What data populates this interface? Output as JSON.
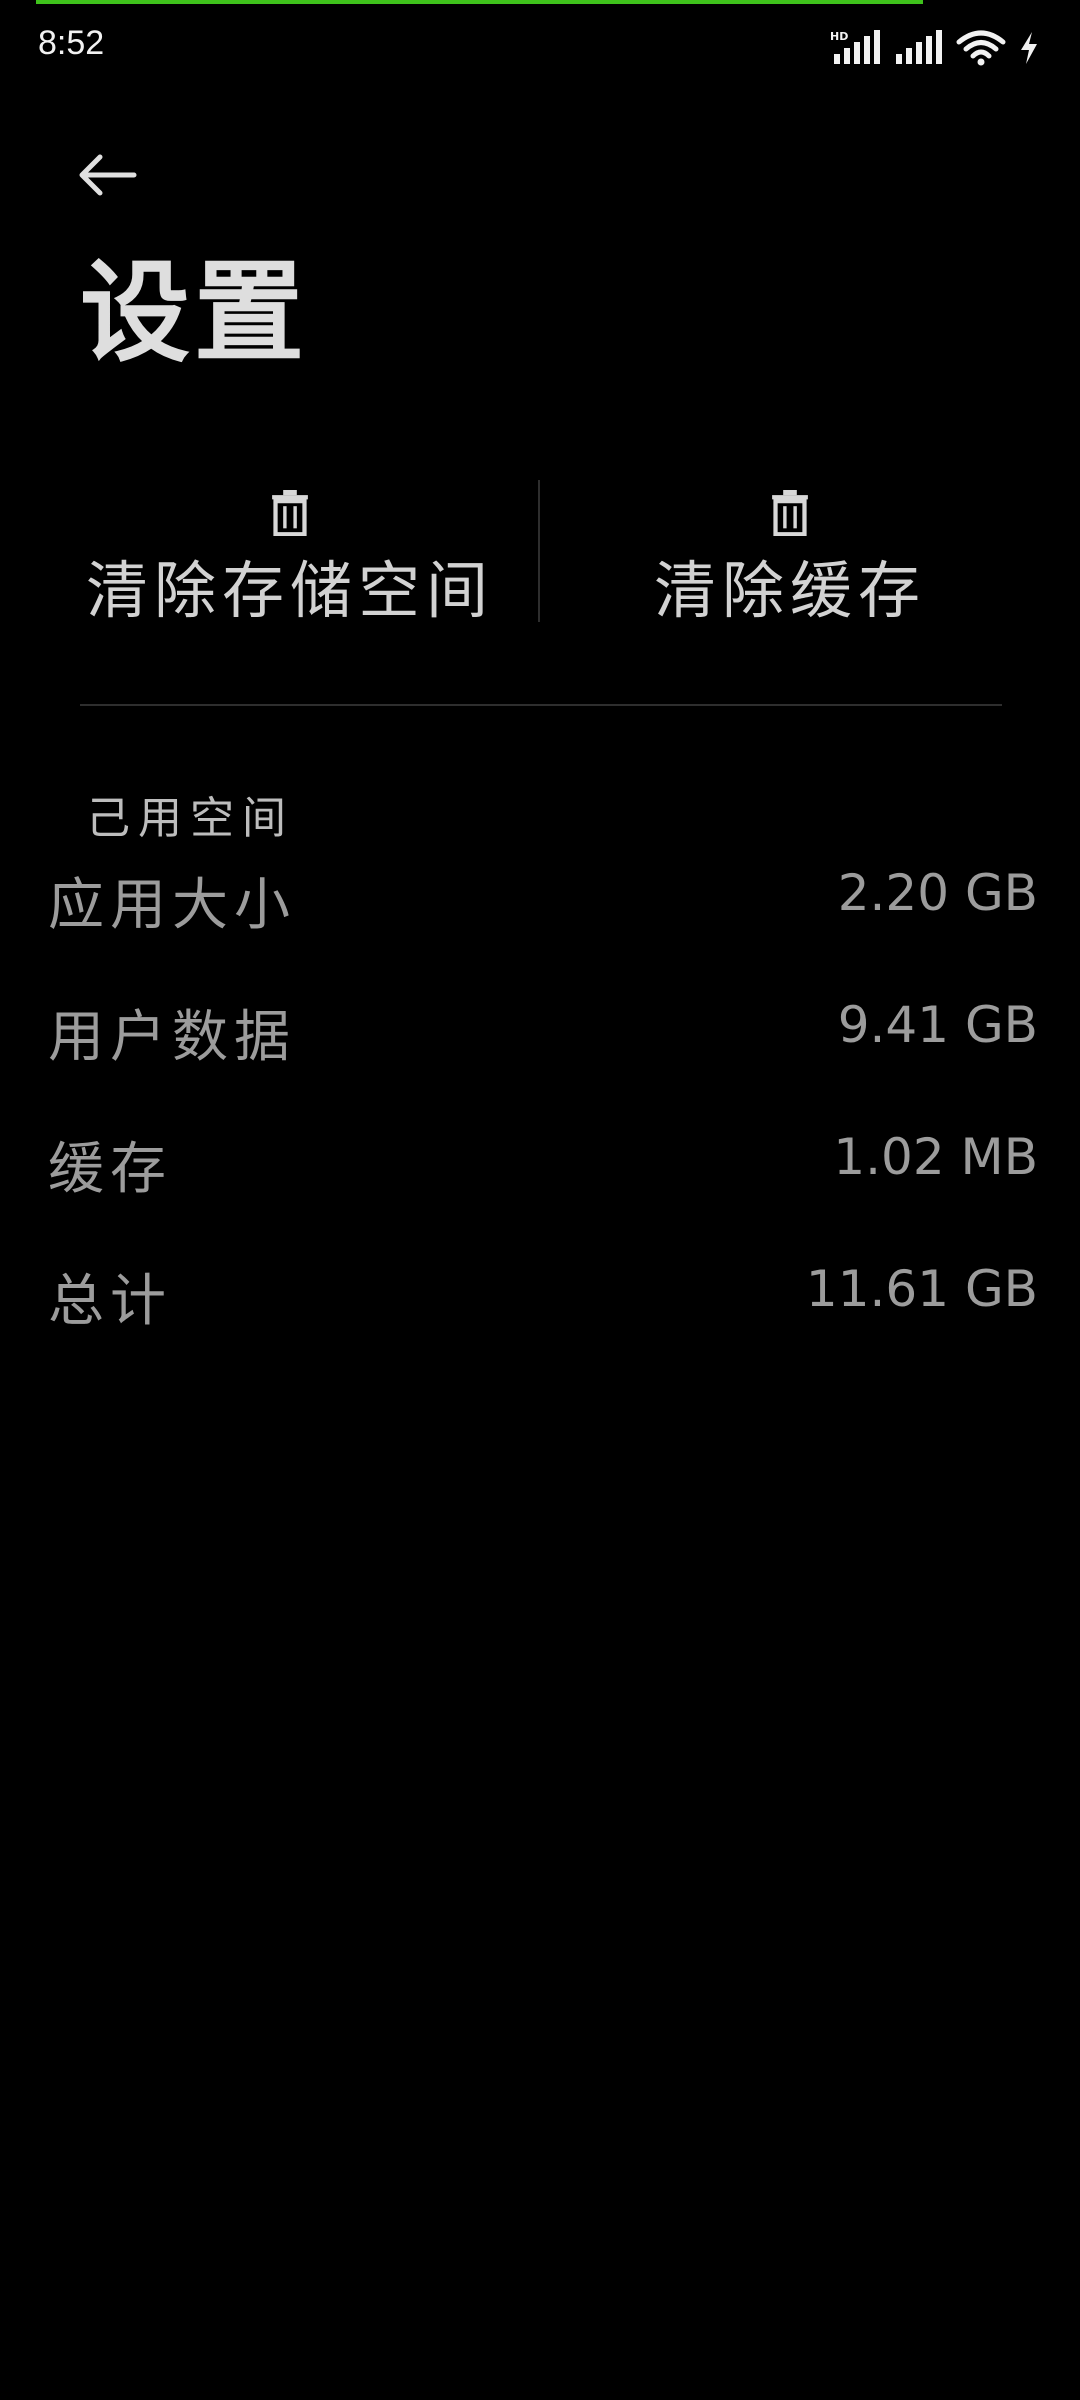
{
  "status_bar": {
    "time": "8:52",
    "network_badge": "HD"
  },
  "header": {
    "title": "设置"
  },
  "actions": {
    "clear_storage_label": "清除存储空间",
    "clear_cache_label": "清除缓存"
  },
  "storage": {
    "section_title": "己用空间",
    "rows": [
      {
        "label": "应用大小",
        "value": "2.20 GB"
      },
      {
        "label": "用户数据",
        "value": "9.41 GB"
      },
      {
        "label": "缓存",
        "value": "1.02 MB"
      },
      {
        "label": "总计",
        "value": "11.61 GB"
      }
    ]
  },
  "icons": {
    "back": "arrow-left-icon",
    "trash": "trash-icon",
    "signal": "cellular-signal-icon",
    "wifi": "wifi-icon",
    "charging": "charging-bolt-icon"
  },
  "colors": {
    "background": "#000000",
    "progress": "#3fc21c",
    "text_primary": "#d6d6d6",
    "text_secondary": "#9c9c9c"
  },
  "progress": {
    "fraction": 0.88
  }
}
